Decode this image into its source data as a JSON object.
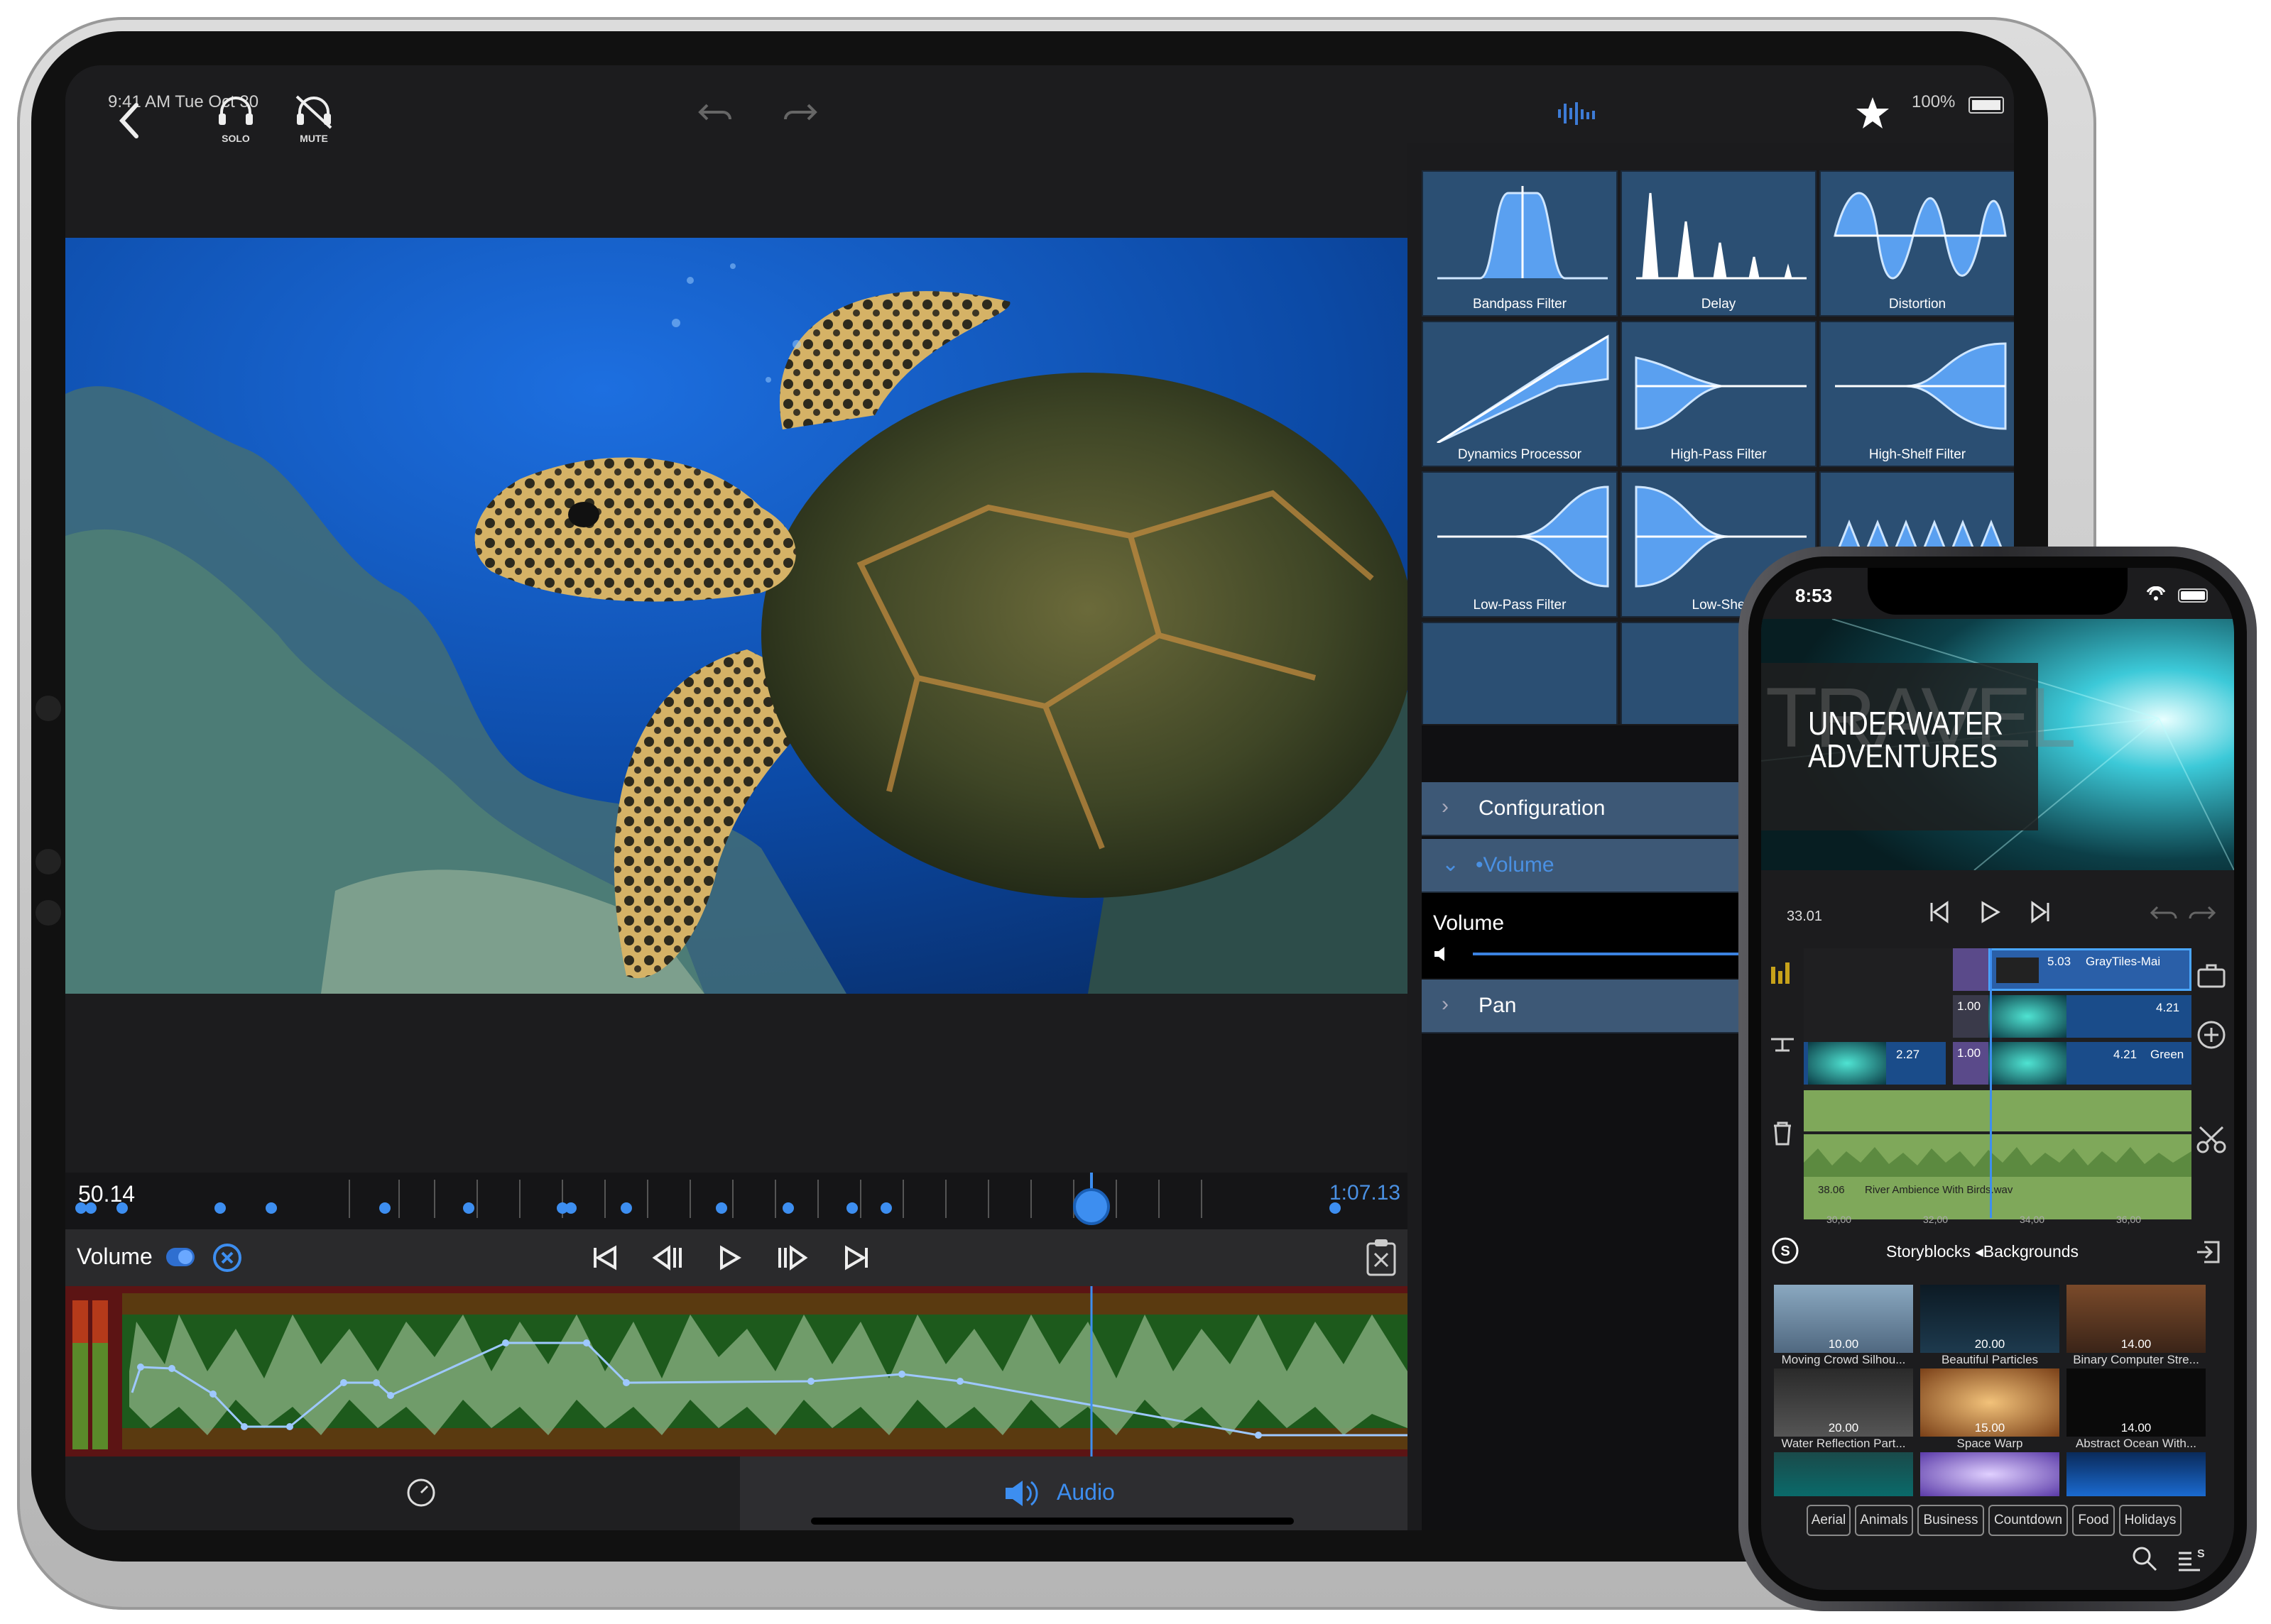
{
  "ipad": {
    "status": {
      "time": "9:41 AM  Tue Oct 30",
      "battery": "100%"
    },
    "toolbar": {
      "solo_label": "SOLO",
      "mute_label": "MUTE"
    },
    "fx_tiles": [
      {
        "label": "Bandpass Filter"
      },
      {
        "label": "Delay"
      },
      {
        "label": "Distortion"
      },
      {
        "label": "Dynamics Processor"
      },
      {
        "label": "High-Pass Filter"
      },
      {
        "label": "High-Shelf Filter"
      },
      {
        "label": "Low-Pass Filter"
      },
      {
        "label": "Low-She"
      }
    ],
    "props": {
      "configuration": "Configuration",
      "volume_header": "•Volume",
      "volume_label": "Volume",
      "pan": "Pan"
    },
    "timeline": {
      "current": "50.14",
      "end": "1:07.13"
    },
    "controls": {
      "track_label": "Volume"
    },
    "bottom": {
      "audio_label": "Audio"
    }
  },
  "iphone": {
    "status": {
      "time": "8:53"
    },
    "title": {
      "line1": "UNDERWATER",
      "line2": "ADVENTURES",
      "bg_word": "TRAVEL"
    },
    "player": {
      "time": "33.01"
    },
    "clips": {
      "a": {
        "dur": "5.03",
        "name": "GrayTiles-Mai"
      },
      "b": {
        "dur": "1.00"
      },
      "c": {
        "dur": "4.21"
      },
      "d": {
        "dur": "2.27"
      },
      "e": {
        "dur": "1.00"
      },
      "f": {
        "dur": "4.21",
        "name": "Green"
      },
      "audio": {
        "dur": "38.06",
        "name": "River Ambience With Birds.wav"
      }
    },
    "ruler": [
      "30,00",
      "32,00",
      "34,00",
      "36,00"
    ],
    "library": {
      "title": "Storyblocks ◂Backgrounds",
      "row1": [
        {
          "dur": "10.00"
        },
        {
          "dur": "20.00"
        },
        {
          "dur": "14.00"
        }
      ],
      "row2": [
        {
          "caption": "Moving Crowd Silhou...",
          "dur": "20.00"
        },
        {
          "caption": "Beautiful Particles",
          "dur": "15.00"
        },
        {
          "caption": "Binary Computer Stre...",
          "dur": "14.00"
        }
      ],
      "row3": [
        {
          "caption": "Water Reflection Part..."
        },
        {
          "caption": "Space Warp"
        },
        {
          "caption": "Abstract Ocean With..."
        }
      ],
      "tags": [
        "Aerial",
        "Animals",
        "Business",
        "Countdown",
        "Food",
        "Holidays"
      ]
    }
  }
}
